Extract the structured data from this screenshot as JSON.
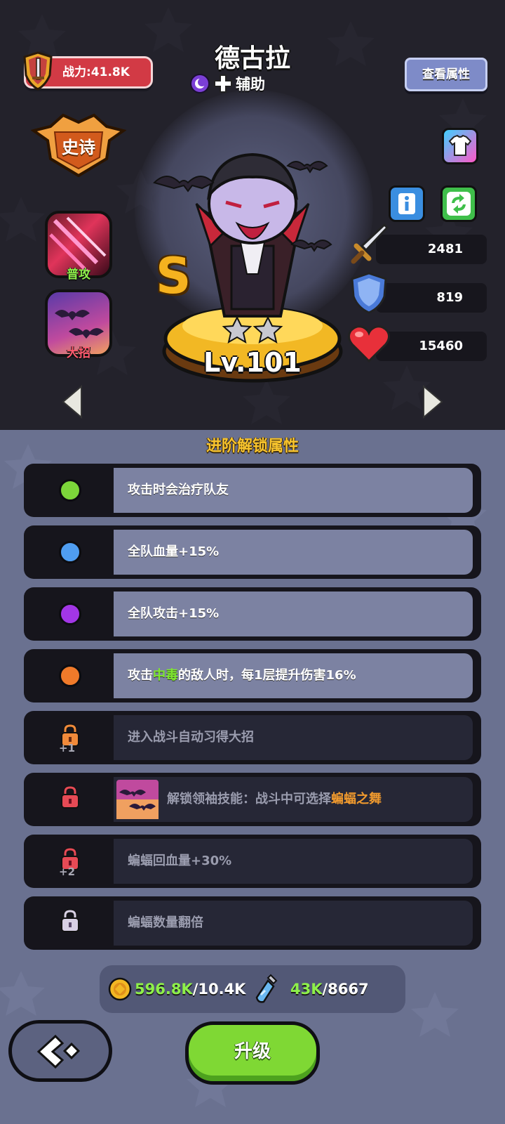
{
  "header": {
    "power_label": "战力:41.8K",
    "hero_name": "德古拉",
    "role": "辅助",
    "view_attributes_label": "查看属性"
  },
  "hero": {
    "rarity": "史诗",
    "grade": "S",
    "level_label": "Lv.101",
    "stars": 2,
    "skills": [
      {
        "label": "普攻",
        "icon": "claw-slash-icon"
      },
      {
        "label": "大招",
        "icon": "bat-swarm-icon"
      }
    ],
    "stats": {
      "attack": "2481",
      "defense": "819",
      "hp": "15460"
    }
  },
  "section_title": "进阶解锁属性",
  "attributes": [
    {
      "text": "攻击时会治疗队友",
      "state": "unlocked",
      "color": "#7cd53a"
    },
    {
      "text": "全队血量+15%",
      "state": "unlocked",
      "color": "#4f9df0"
    },
    {
      "text": "全队攻击+15%",
      "state": "unlocked",
      "color": "#a236e6"
    },
    {
      "pre": "攻击",
      "hl": "中毒",
      "post": "的敌人时，每1层提升伤害16%",
      "state": "unlocked",
      "color": "#f07a2a"
    },
    {
      "text": "进入战斗自动习得大招",
      "state": "locked",
      "lock_color": "#f08a3a",
      "lock_num": "+1"
    },
    {
      "pre": "解锁领袖技能：战斗中可选择",
      "hl": "蝙蝠之舞",
      "state": "locked",
      "lock_color": "#e64a55"
    },
    {
      "text": "蝙蝠回血量+30%",
      "state": "locked",
      "lock_color": "#e64a55",
      "lock_num": "+2"
    },
    {
      "text": "蝙蝠数量翻倍",
      "state": "locked",
      "lock_color": "#d8d0e4"
    }
  ],
  "resources": {
    "gold_have": "596.8K",
    "gold_need": "/10.4K",
    "potion_have": "43K",
    "potion_need": "/8667"
  },
  "buttons": {
    "upgrade": "升级"
  }
}
